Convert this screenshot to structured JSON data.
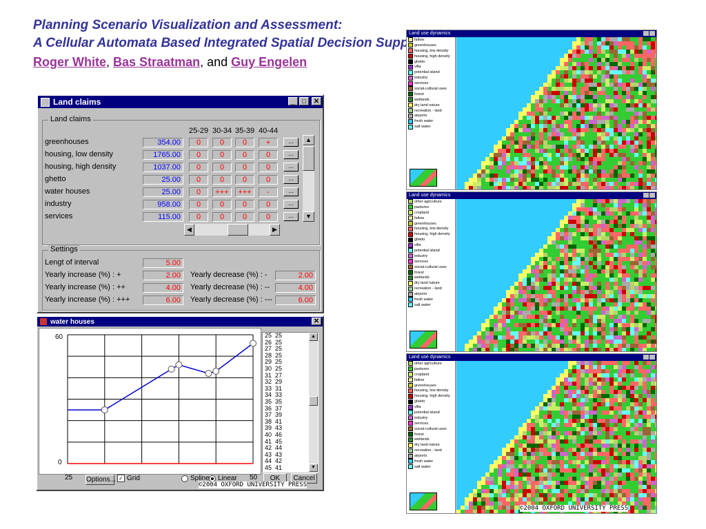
{
  "header": {
    "title_line1": "Planning Scenario Visualization and Assessment:",
    "title_line2": "A Cellular Automata Based Integrated Spatial Decision Support System",
    "author1": "Roger White",
    "sep1": ",",
    "author2": "Bas Straatman",
    "sep2": ", and",
    "author3": "Guy Engelen"
  },
  "land_claims_window": {
    "title": "Land claims",
    "group_label": "Land claims",
    "column_headers": [
      "25-29",
      "30-34",
      "35-39",
      "40-44"
    ],
    "rows": [
      {
        "label": "greenhouses",
        "value": "354.00",
        "cells": [
          "0",
          "0",
          "0",
          "+"
        ]
      },
      {
        "label": "housing, low density",
        "value": "1765.00",
        "cells": [
          "0",
          "0",
          "0",
          "0"
        ]
      },
      {
        "label": "housing, high density",
        "value": "1037.00",
        "cells": [
          "0",
          "0",
          "0",
          "0"
        ]
      },
      {
        "label": "ghetto",
        "value": "25.00",
        "cells": [
          "0",
          "0",
          "0",
          "0"
        ]
      },
      {
        "label": "water houses",
        "value": "25.00",
        "cells": [
          "0",
          "+++",
          "+++",
          "-"
        ]
      },
      {
        "label": "industry",
        "value": "958.00",
        "cells": [
          "0",
          "0",
          "0",
          "0"
        ]
      },
      {
        "label": "services",
        "value": "115.00",
        "cells": [
          "0",
          "0",
          "0",
          "0"
        ]
      }
    ],
    "row_button": "...",
    "settings": {
      "group_label": "Settings",
      "interval_label": "Lengt of interval",
      "interval_value": "5.00",
      "inc1_label": "Yearly increase (%) : +",
      "inc1_value": "2.00",
      "inc2_label": "Yearly increase (%) : ++",
      "inc2_value": "4.00",
      "inc3_label": "Yearly increase (%) : +++",
      "inc3_value": "6.00",
      "dec1_label": "Yearly decrease (%) : -",
      "dec1_value": "2.00",
      "dec2_label": "Yearly decrease (%) : --",
      "dec2_value": "4.00",
      "dec3_label": "Yearly decrease (%) : ---",
      "dec3_value": "6.00"
    }
  },
  "water_houses_window": {
    "title": "water houses",
    "y_max_label": "60",
    "y_min_label": "0",
    "x_min_label": "25",
    "x_max_label": "50",
    "options_button": "Options...",
    "grid_label": "Grid",
    "grid_checked": true,
    "spline_label": "Spline",
    "linear_label": "Linear",
    "interpolation": "Linear",
    "ok_button": "OK",
    "cancel_button": "Cancel",
    "copyright": "©2004 OXFORD UNIVERSITY PRESS",
    "list": [
      [
        "25",
        "25"
      ],
      [
        "26",
        "25"
      ],
      [
        "27",
        "25"
      ],
      [
        "28",
        "25"
      ],
      [
        "29",
        "25"
      ],
      [
        "30",
        "25"
      ],
      [
        "31",
        "27"
      ],
      [
        "32",
        "29"
      ],
      [
        "33",
        "31"
      ],
      [
        "34",
        "33"
      ],
      [
        "35",
        "35"
      ],
      [
        "36",
        "37"
      ],
      [
        "37",
        "39"
      ],
      [
        "38",
        "41"
      ],
      [
        "39",
        "43"
      ],
      [
        "40",
        "46"
      ],
      [
        "41",
        "45"
      ],
      [
        "42",
        "44"
      ],
      [
        "43",
        "43"
      ],
      [
        "44",
        "42"
      ],
      [
        "45",
        "41"
      ]
    ]
  },
  "chart_data": {
    "type": "line",
    "xlim": [
      25,
      50
    ],
    "ylim": [
      0,
      60
    ],
    "grid": true,
    "series": [
      {
        "x": [
          25,
          30,
          39,
          40,
          44,
          45,
          50
        ],
        "y": [
          25,
          25,
          44,
          46,
          42,
          43,
          56
        ],
        "markers": [
          false,
          true,
          true,
          true,
          true,
          true,
          true
        ]
      }
    ],
    "x_axis_line": {
      "y": 0
    },
    "colors": {
      "line": "#0000cc",
      "axis": "#ff0000"
    }
  },
  "map_windows": {
    "title": "Land use dynamics",
    "copyright": "©2004 OXFORD UNIVERSITY PRESS",
    "legend": [
      {
        "label": "other agriculture",
        "color": "#b5d46a"
      },
      {
        "label": "pastures",
        "color": "#33cc33"
      },
      {
        "label": "cropland",
        "color": "#ccee66"
      },
      {
        "label": "fallow",
        "color": "#e8e8a0"
      },
      {
        "label": "greenhouses",
        "color": "#cccc33"
      },
      {
        "label": "housing, low density",
        "color": "#ff6666"
      },
      {
        "label": "housing, high density",
        "color": "#cc0000"
      },
      {
        "label": "ghetto",
        "color": "#000000"
      },
      {
        "label": "villa",
        "color": "#9933cc"
      },
      {
        "label": "potential island",
        "color": "#66ffff"
      },
      {
        "label": "industry",
        "color": "#cc66cc"
      },
      {
        "label": "services",
        "color": "#ff33cc"
      },
      {
        "label": "social-cultural uses",
        "color": "#996633"
      },
      {
        "label": "forest",
        "color": "#006600"
      },
      {
        "label": "wetlands",
        "color": "#338833"
      },
      {
        "label": "dry land nature",
        "color": "#ffff66"
      },
      {
        "label": "recreation - land",
        "color": "#99cc99"
      },
      {
        "label": "airports",
        "color": "#aaaaaa"
      },
      {
        "label": "fresh water",
        "color": "#33ccff"
      },
      {
        "label": "salt water",
        "color": "#66ffff"
      }
    ]
  }
}
